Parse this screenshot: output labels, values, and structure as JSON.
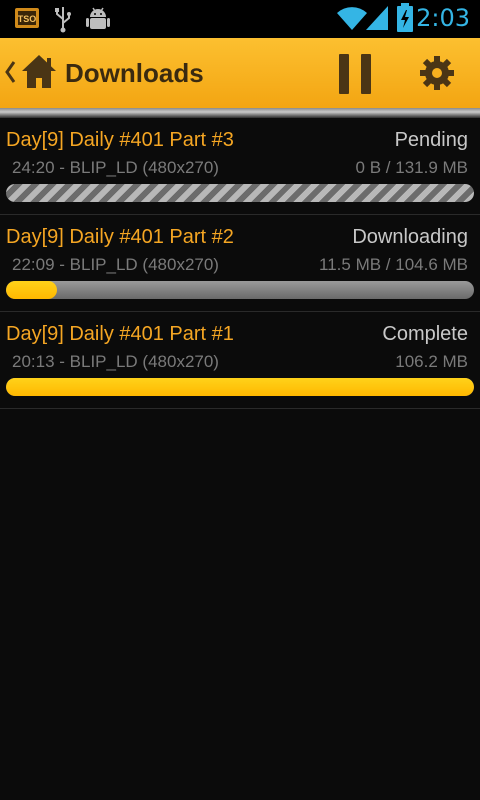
{
  "status_bar": {
    "time": "2:03",
    "icons": [
      "notification-app-icon",
      "usb-icon",
      "android-debug-icon",
      "wifi-icon",
      "signal-icon",
      "battery-charging-icon"
    ]
  },
  "action_bar": {
    "title": "Downloads",
    "icons": [
      "up-caret-icon",
      "home-icon",
      "pause-icon",
      "settings-icon"
    ]
  },
  "downloads": [
    {
      "name": "Day[9] Daily #401 Part #3",
      "status": "Pending",
      "meta": "24:20 - BLIP_LD (480x270)",
      "size": "0 B / 131.9 MB",
      "progress": 0,
      "state": "pending"
    },
    {
      "name": "Day[9] Daily #401 Part #2",
      "status": "Downloading",
      "meta": "22:09 - BLIP_LD (480x270)",
      "size": "11.5 MB / 104.6 MB",
      "progress": 0.11,
      "state": "downloading"
    },
    {
      "name": "Day[9] Daily #401 Part #1",
      "status": "Complete",
      "meta": "20:13 - BLIP_LD (480x270)",
      "size": "106.2 MB",
      "progress": 1.0,
      "state": "complete"
    }
  ],
  "colors": {
    "accent": "#f5a623",
    "progress": "#ffc107",
    "status_icons": "#34b5e5"
  }
}
